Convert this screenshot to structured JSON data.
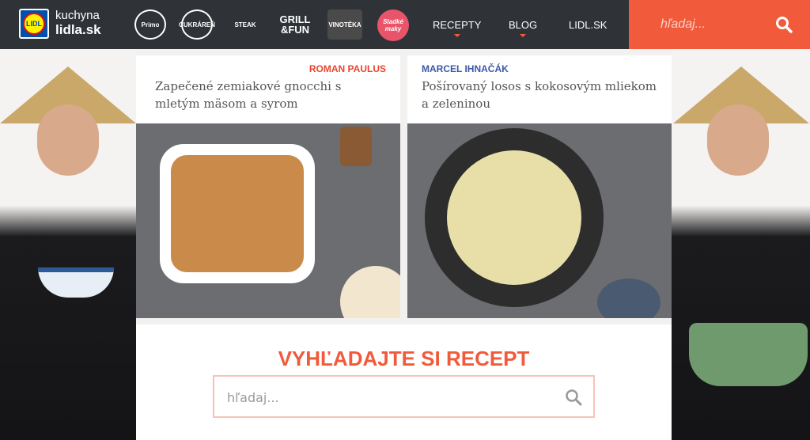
{
  "header": {
    "logo_text": "LIDL",
    "brand_line1": "kuchyna",
    "brand_line2": "lidla.sk",
    "partners": [
      {
        "name": "Primo",
        "text": "Primo"
      },
      {
        "name": "Tvoje Cukráreň",
        "text": "CUKRÁREŇ"
      },
      {
        "name": "Chill Steak",
        "text": "STEAK"
      },
      {
        "name": "Grill & Fun",
        "text": "GRILL &FUN"
      },
      {
        "name": "Vinotéka",
        "text": "VINOTÉKA"
      },
      {
        "name": "Sladké Maky",
        "text": "Sladké maky"
      }
    ],
    "nav": [
      {
        "label": "RECEPTY",
        "has_caret": true
      },
      {
        "label": "BLOG",
        "has_caret": true
      },
      {
        "label": "LIDL.SK",
        "has_caret": false
      }
    ],
    "search_placeholder": "hľadaj...",
    "accent_color": "#f15a3a"
  },
  "recipes": [
    {
      "author": "ROMAN PAULUS",
      "author_color": "#e8452c",
      "title": "Zapečené zemiakové gnocchi s mletým mäsom a syrom"
    },
    {
      "author": "MARCEL IHNAČÁK",
      "author_color": "#3b57a8",
      "title": "Pošírovaný losos s kokosovým mliekom a zeleninou"
    }
  ],
  "search_panel": {
    "heading": "VYHĽADAJTE SI RECEPT",
    "placeholder": "hľadaj..."
  }
}
